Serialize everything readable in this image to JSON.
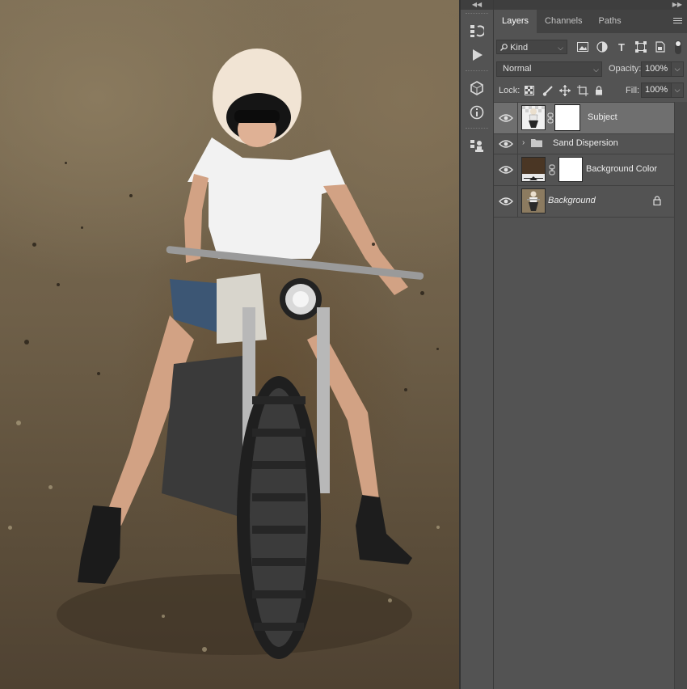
{
  "panel_tabs": [
    {
      "label": "Layers",
      "active": true
    },
    {
      "label": "Channels",
      "active": false
    },
    {
      "label": "Paths",
      "active": false
    }
  ],
  "filter": {
    "kind_label": "Kind"
  },
  "blend_mode": "Normal",
  "opacity": {
    "label": "Opacity:",
    "value": "100%"
  },
  "lock": {
    "label": "Lock:"
  },
  "fill": {
    "label": "Fill:",
    "value": "100%"
  },
  "layers": [
    {
      "name": "Subject",
      "visible": true,
      "selected": true,
      "has_mask": true,
      "type": "pixel"
    },
    {
      "name": "Sand Dispersion",
      "visible": true,
      "selected": false,
      "type": "group",
      "collapsed": true
    },
    {
      "name": "Background Color",
      "visible": true,
      "selected": false,
      "has_mask": true,
      "type": "fill",
      "fill_color": "#4a3624"
    },
    {
      "name": "Background",
      "visible": true,
      "selected": false,
      "locked": true,
      "italic": true,
      "type": "background"
    }
  ],
  "colors": {
    "panel_bg": "#535353",
    "selected_row": "#6f6f6f",
    "tab_bar": "#424242"
  }
}
